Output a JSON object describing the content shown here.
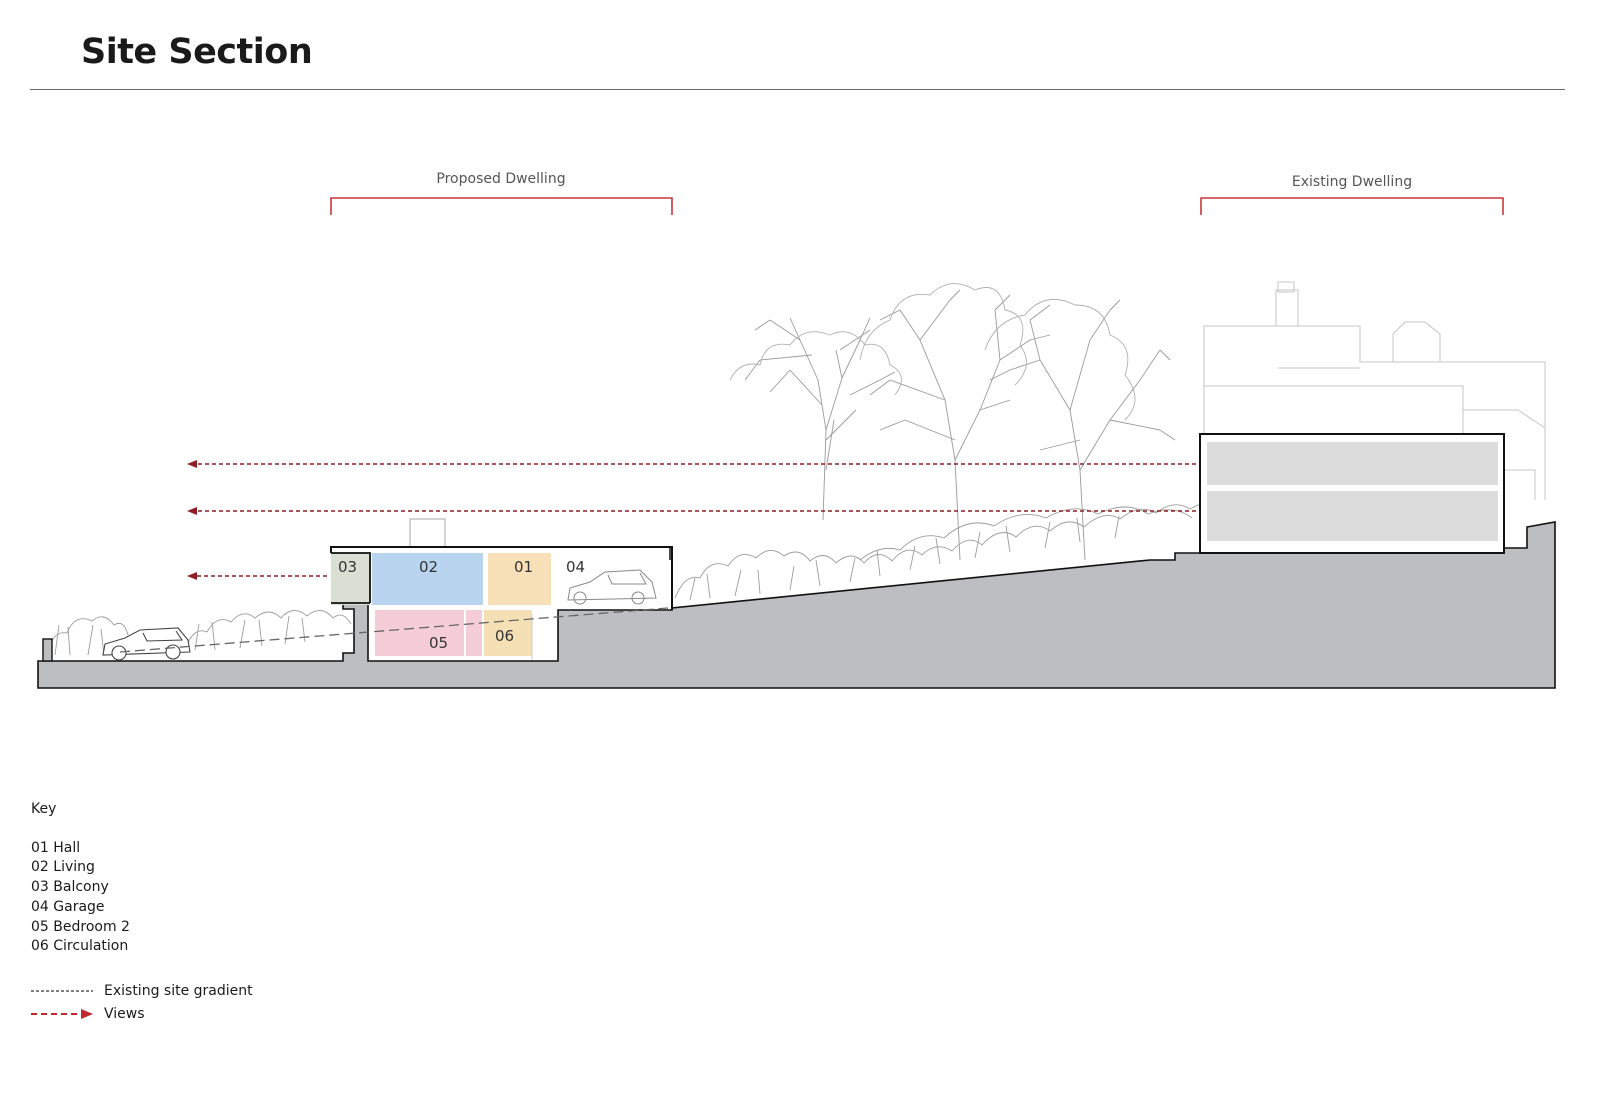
{
  "title": "Site Section",
  "brackets": {
    "proposed": "Proposed Dwelling",
    "existing": "Existing Dwelling"
  },
  "rooms": [
    "01",
    "02",
    "03",
    "04",
    "05",
    "06"
  ],
  "key": {
    "title": "Key",
    "items": [
      "01 Hall",
      "02 Living",
      "03 Balcony",
      "04 Garage",
      "05 Bedroom 2",
      "06 Circulation"
    ]
  },
  "legend": {
    "gradient": "Existing site gradient",
    "views": "Views"
  },
  "colors": {
    "ground": "#bdbebf",
    "bracket": "#c8373a",
    "views": "#8b1f23",
    "hall": "#f7dfb7",
    "living": "#b8d4ef",
    "balcony": "#d9dfd3",
    "bedroom": "#f5cdd9",
    "circulation": "#f5dfb5",
    "existing_floor": "#dcdcdd"
  }
}
